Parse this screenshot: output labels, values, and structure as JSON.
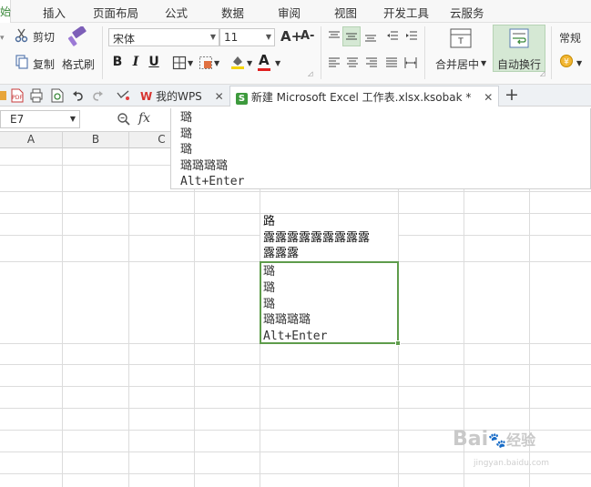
{
  "menu": {
    "active_stub": "始",
    "tabs": [
      "插入",
      "页面布局",
      "公式",
      "数据",
      "审阅",
      "视图",
      "开发工具",
      "云服务"
    ]
  },
  "ribbon": {
    "cut": "剪切",
    "copy": "复制",
    "format_painter": "格式刷",
    "font_name": "宋体",
    "font_size": "11",
    "merge_center": "合并居中",
    "wrap_text": "自动换行",
    "number_format": "常规",
    "bold": "B",
    "italic": "I",
    "underline": "U",
    "font_color_letter": "A",
    "grow_font": "A+",
    "shrink_font": "A-",
    "accent_color": "#3d8a3d",
    "font_color_bar": "#e02020",
    "fill_color_bar": "#f5d400"
  },
  "doc_tabs": {
    "my_wps": "我的WPS",
    "file_tab": "新建 Microsoft Excel 工作表.xlsx.ksobak *",
    "close": "✕",
    "add": "+"
  },
  "formula_bar": {
    "name_box": "E7",
    "fx": "fx",
    "content_lines": [
      "璐",
      "璐",
      "璐",
      "璐璐璐璐",
      "Alt+Enter"
    ]
  },
  "columns": [
    "A",
    "B",
    "C"
  ],
  "cells": {
    "e4": "路",
    "e5": "露露露露露露露露露",
    "e6": "露露露",
    "e7_lines": [
      "璐",
      "璐",
      "璐",
      "璐璐璐璐",
      "Alt+Enter"
    ]
  },
  "watermark": {
    "brand": "Bai",
    "suffix": "经验",
    "url": "jingyan.baidu.com"
  }
}
